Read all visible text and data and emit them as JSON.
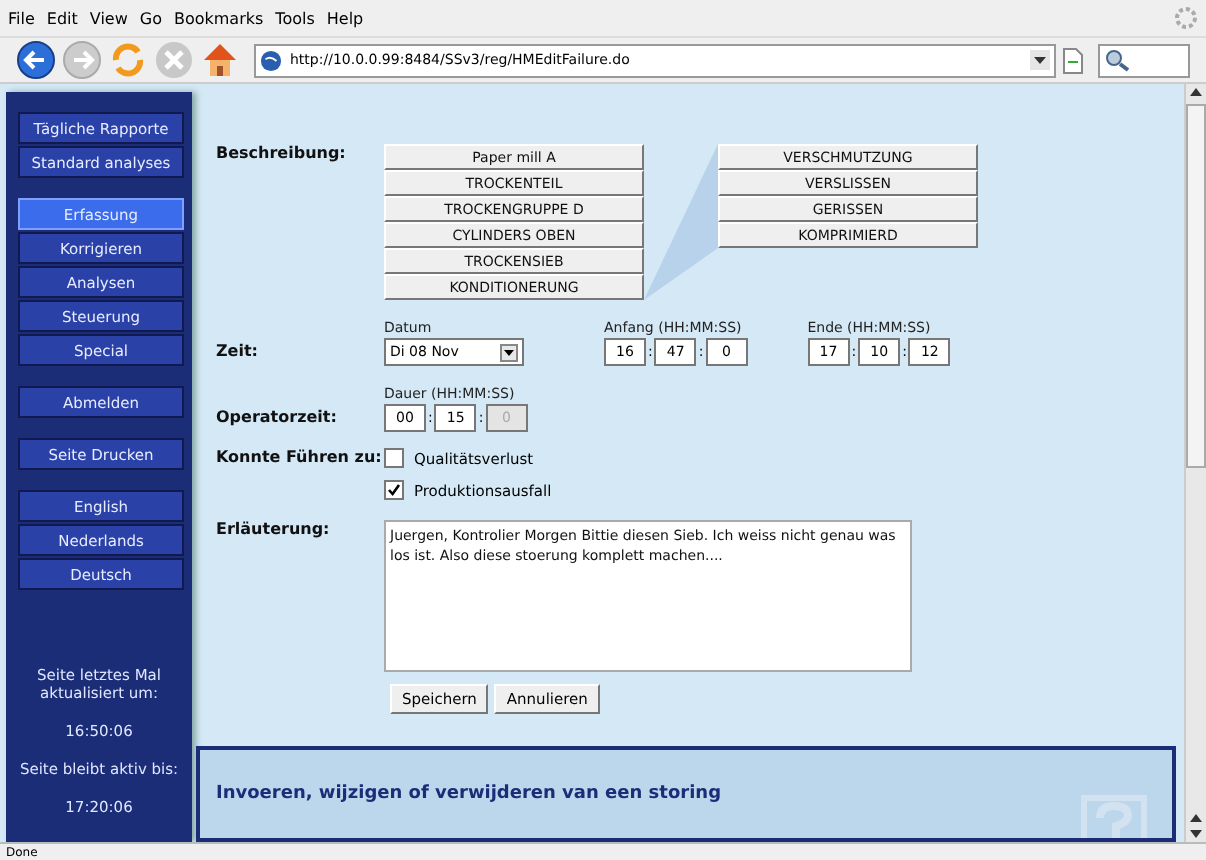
{
  "menu": [
    "File",
    "Edit",
    "View",
    "Go",
    "Bookmarks",
    "Tools",
    "Help"
  ],
  "url": "http://10.0.0.99:8484/SSv3/reg/HMEditFailure.do",
  "sidebar": {
    "groups": [
      [
        {
          "label": "Tägliche Rapporte",
          "selected": false
        },
        {
          "label": "Standard analyses",
          "selected": false
        }
      ],
      [
        {
          "label": "Erfassung",
          "selected": true
        },
        {
          "label": "Korrigieren",
          "selected": false
        },
        {
          "label": "Analysen",
          "selected": false
        },
        {
          "label": "Steuerung",
          "selected": false
        },
        {
          "label": "Special",
          "selected": false
        }
      ],
      [
        {
          "label": "Abmelden",
          "selected": false
        }
      ],
      [
        {
          "label": "Seite Drucken",
          "selected": false
        }
      ],
      [
        {
          "label": "English",
          "selected": false
        },
        {
          "label": "Nederlands",
          "selected": false
        },
        {
          "label": "Deutsch",
          "selected": false
        }
      ]
    ],
    "updated_label": "Seite letztes Mal aktualisiert um:",
    "updated_time": "16:50:06",
    "active_label": "Seite bleibt aktiv bis:",
    "active_time": "17:20:06"
  },
  "form": {
    "beschreibung_label": "Beschreibung:",
    "path": [
      "Paper mill A",
      "TROCKENTEIL",
      "TROCKENGRUPPE D",
      "CYLINDERS OBEN",
      "TROCKENSIEB",
      "KONDITIONERUNG"
    ],
    "options": [
      "VERSCHMUTZUNG",
      "VERSLISSEN",
      "GERISSEN",
      "KOMPRIMIERD"
    ],
    "zeit_label": "Zeit:",
    "datum_label": "Datum",
    "datum": "Di 08 Nov",
    "anfang_label": "Anfang (HH:MM:SS)",
    "anfang": [
      "16",
      "47",
      "0"
    ],
    "anfang_sep": [
      ":",
      ":"
    ],
    "ende_label": "Ende (HH:MM:SS)",
    "ende": [
      "17",
      "10",
      "12"
    ],
    "ende_sep": [
      ":",
      ":"
    ],
    "operator_label": "Operatorzeit:",
    "dauer_label": "Dauer (HH:MM:SS)",
    "dauer": [
      {
        "value": "00",
        "disabled": false
      },
      {
        "value": "15",
        "disabled": false
      },
      {
        "value": "0",
        "disabled": true
      }
    ],
    "dauer_sep": [
      ":",
      ":"
    ],
    "konnte_label": "Konnte Führen zu:",
    "checks": [
      {
        "label": "Qualitätsverlust",
        "checked": false
      },
      {
        "label": "Produktionsausfall",
        "checked": true
      }
    ],
    "erl_label": "Erläuterung:",
    "erl_text": "Juergen, Kontrolier Morgen Bittie diesen Sieb. Ich weiss nicht genau was los ist. Also diese stoerung komplett machen....",
    "buttons": [
      "Speichern",
      "Annulieren"
    ]
  },
  "help_panel": {
    "title": "Invoeren, wijzigen of verwijderen van een storing"
  },
  "status_bar": "Done"
}
